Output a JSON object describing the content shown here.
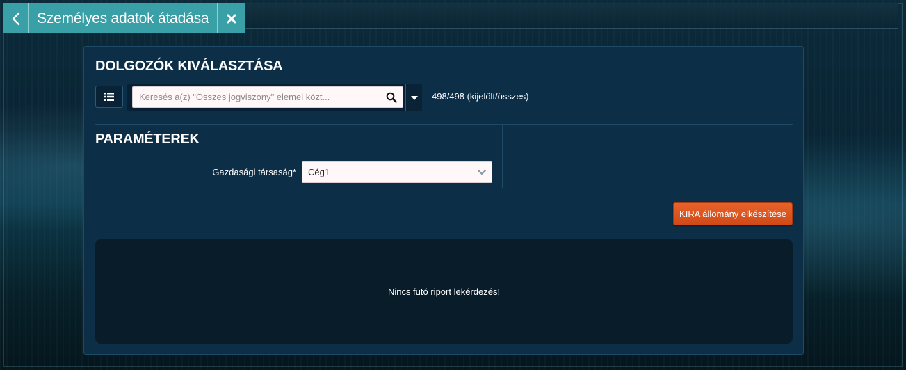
{
  "window": {
    "title": "Személyes adatok átadása"
  },
  "icons": {
    "back": "chevron-left-icon",
    "close": "close-x-icon",
    "list": "list-icon",
    "search": "search-icon",
    "dropdown": "caret-down-icon",
    "select_chevron": "chevron-down-icon"
  },
  "colors": {
    "titlebar": "#3aa0a8",
    "panel": "#0d2e47",
    "primary_action": "#d9521e"
  },
  "employees": {
    "heading": "DOLGOZÓK KIVÁLASZTÁSA",
    "search_placeholder": "Keresés a(z) \"Összes jogviszony\" elemei közt...",
    "search_value": "",
    "count_text": "498/498 (kijelölt/összes)"
  },
  "parameters": {
    "heading": "PARAMÉTEREK",
    "company_label": "Gazdasági társaság*",
    "company_value": "Cég1"
  },
  "actions": {
    "kira_button": "KIRA állomány elkészítése"
  },
  "report": {
    "empty_message": "Nincs futó riport lekérdezés!"
  }
}
